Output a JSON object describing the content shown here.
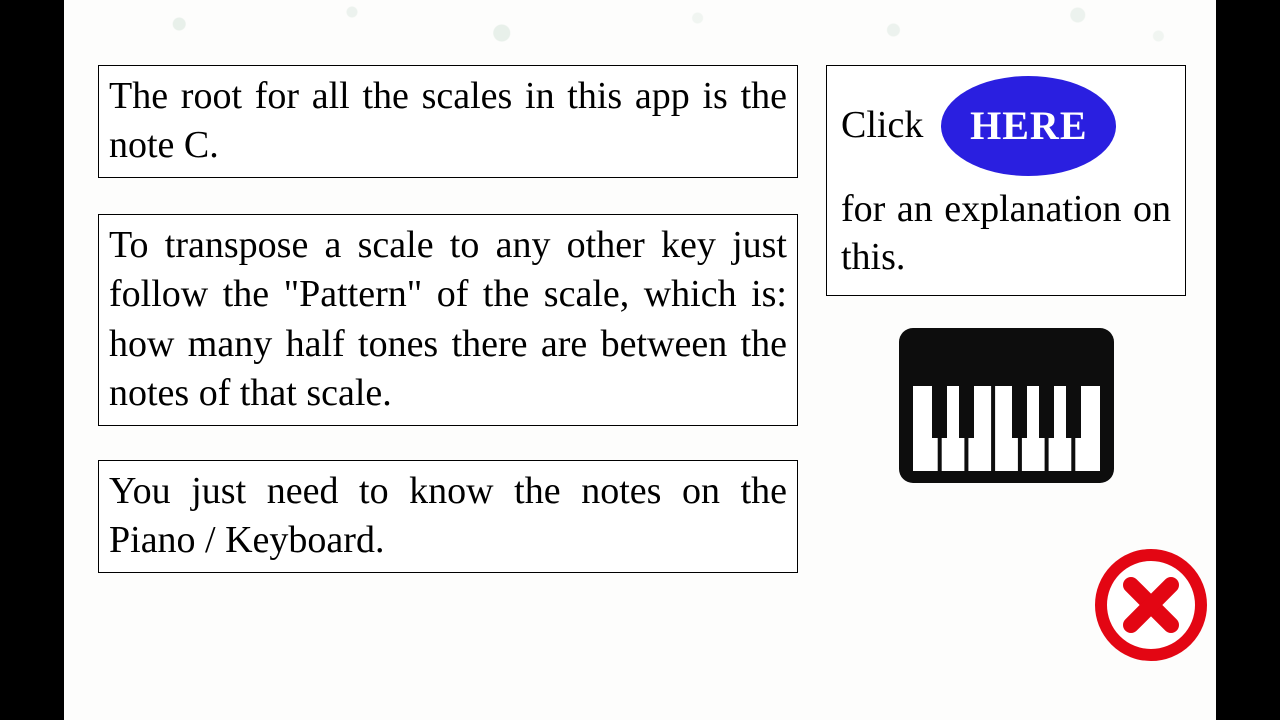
{
  "info": {
    "box1": "The root for all the scales in this app is the note C.",
    "box2": "To transpose a scale to any other key just follow the \"Pattern\" of the scale, which is: how many half tones there are between the notes of that scale.",
    "box3": "You just need to know the notes on the Piano / Keyboard."
  },
  "side": {
    "click": "Click",
    "here": "HERE",
    "rest": "for an explanation on this."
  },
  "icons": {
    "piano": "piano-icon",
    "close": "close-icon"
  },
  "colors": {
    "accent": "#2a1fe0",
    "danger": "#e30613"
  }
}
